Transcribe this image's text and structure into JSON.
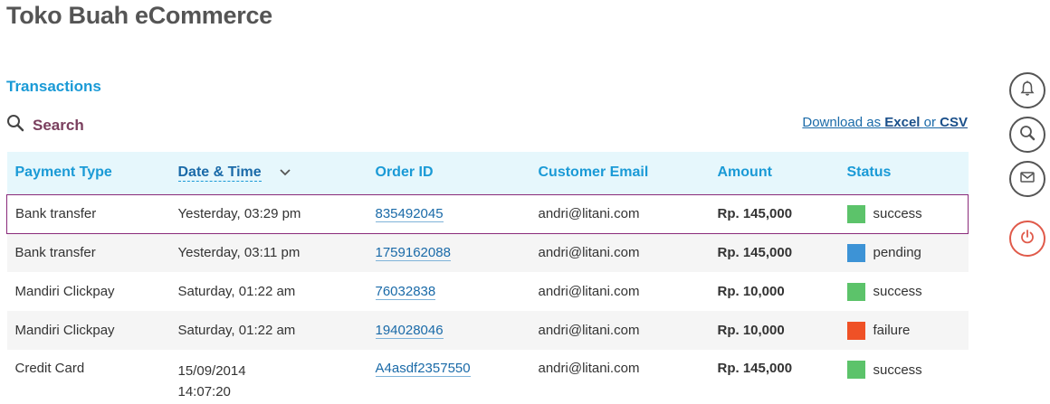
{
  "app": {
    "title": "Toko Buah eCommerce"
  },
  "section": {
    "title": "Transactions"
  },
  "search": {
    "label": "Search"
  },
  "download": {
    "prefix": "Download as",
    "excel": "Excel",
    "or": "or",
    "csv": "CSV"
  },
  "table": {
    "headers": {
      "payment_type": "Payment Type",
      "date_time": "Date & Time",
      "order_id": "Order ID",
      "customer_email": "Customer Email",
      "amount": "Amount",
      "status": "Status"
    },
    "rows": [
      {
        "payment_type": "Bank transfer",
        "date_time": "Yesterday, 03:29 pm",
        "date_time_2": "",
        "order_id": "835492045",
        "email": "andri@litani.com",
        "amount": "Rp. 145,000",
        "status": "success",
        "status_color": "#5cc36a"
      },
      {
        "payment_type": "Bank transfer",
        "date_time": "Yesterday, 03:11 pm",
        "date_time_2": "",
        "order_id": "1759162088",
        "email": "andri@litani.com",
        "amount": "Rp. 145,000",
        "status": "pending",
        "status_color": "#3d93d6"
      },
      {
        "payment_type": "Mandiri Clickpay",
        "date_time": "Saturday, 01:22 am",
        "date_time_2": "",
        "order_id": "76032838",
        "email": "andri@litani.com",
        "amount": "Rp. 10,000",
        "status": "success",
        "status_color": "#5cc36a"
      },
      {
        "payment_type": "Mandiri Clickpay",
        "date_time": "Saturday, 01:22 am",
        "date_time_2": "",
        "order_id": "194028046",
        "email": "andri@litani.com",
        "amount": "Rp. 10,000",
        "status": "failure",
        "status_color": "#ef5126"
      },
      {
        "payment_type": "Credit Card",
        "date_time": "15/09/2014",
        "date_time_2": "14:07:20",
        "order_id": "A4asdf2357550",
        "email": "andri@litani.com",
        "amount": "Rp. 145,000",
        "status": "success",
        "status_color": "#5cc36a"
      }
    ]
  },
  "sidebar": {
    "buttons": [
      {
        "name": "notifications-button",
        "icon": "bell-icon"
      },
      {
        "name": "search-button",
        "icon": "search-icon"
      },
      {
        "name": "messages-button",
        "icon": "mail-icon"
      },
      {
        "name": "logout-button",
        "icon": "power-icon",
        "color": "#e05a4a"
      }
    ]
  }
}
